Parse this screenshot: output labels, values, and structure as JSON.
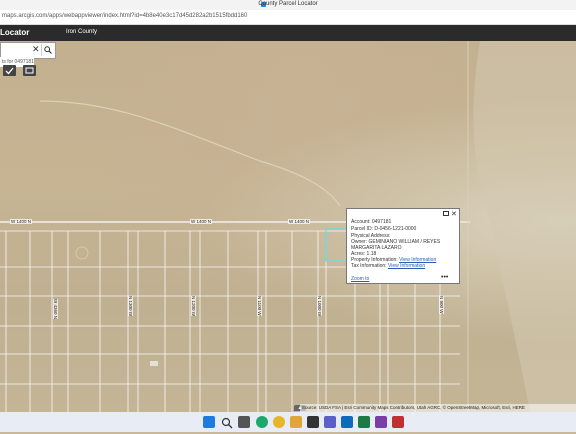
{
  "browser": {
    "window_title": "County Parcel Locator",
    "url": "maps.arcgis.com/apps/webappviewer/index.html?id=4b8e40e3c17d45d282a2b1515fbdd160"
  },
  "app": {
    "title": "Locator",
    "tab": "Iron County"
  },
  "search": {
    "clear_glyph": "✕",
    "results_text": "ts for 0497181"
  },
  "roads": {
    "top_row": [
      "W 1400 N",
      "W 1400 N",
      "W 1400 N"
    ],
    "vertical": [
      "W 4360 N",
      "N 1300 W",
      "N 1200 W",
      "N 1100 W",
      "N 1000 W",
      "N 900 W"
    ]
  },
  "popup": {
    "account": "Account: 0497181",
    "parcel_id": "Parcel ID: D-0456-1221-0000",
    "physical_address": "Physical Address:",
    "owner": "Owner: GEMINIANO WILLIAM / REYES",
    "owner_line2": "MARGARITA LAZARO",
    "acres": "Acres: 1.18",
    "property_info_label": "Property Information:",
    "property_info_link": "View Information",
    "tax_info_label": "Tax Information:",
    "tax_info_link": "View Information",
    "zoom_to": "Zoom to",
    "more": "•••",
    "close": "✕"
  },
  "attribution": "Source: USDA FSA | Esri Community Maps Contributors, Utah AGRC, © OpenStreetMap, Microsoft, Esri, HERE",
  "taskbar": {
    "icons": [
      "windows-icon",
      "search-icon",
      "task-view-icon",
      "edge-icon",
      "chrome-icon",
      "file-explorer-icon",
      "store-icon",
      "teams-icon",
      "mail-icon",
      "excel-icon",
      "vpn-icon",
      "app-icon"
    ]
  },
  "colors": {
    "header": "#2b2b2b",
    "link": "#2a5db0",
    "parcel_line": "#ffffff",
    "selected_parcel": "#5fe0e6"
  }
}
